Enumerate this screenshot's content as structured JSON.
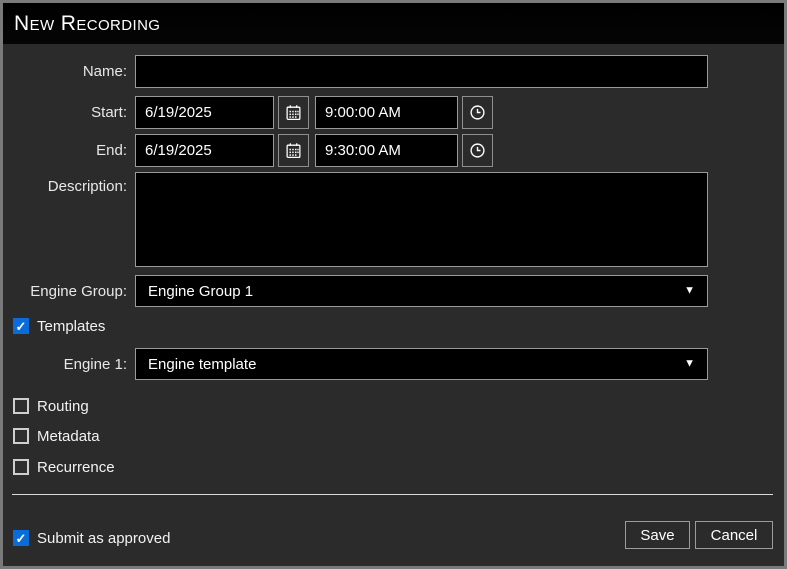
{
  "window": {
    "title": "New Recording"
  },
  "form": {
    "name": {
      "label": "Name:",
      "value": ""
    },
    "start": {
      "label": "Start:",
      "date": "6/19/2025",
      "time": "9:00:00 AM"
    },
    "end": {
      "label": "End:",
      "date": "6/19/2025",
      "time": "9:30:00 AM"
    },
    "description": {
      "label": "Description:",
      "value": ""
    },
    "engine_group": {
      "label": "Engine Group:",
      "selected": "Engine Group 1"
    },
    "engine_1": {
      "label": "Engine 1:",
      "selected": "Engine template"
    }
  },
  "checkboxes": {
    "templates": {
      "label": "Templates",
      "checked": true
    },
    "routing": {
      "label": "Routing",
      "checked": false
    },
    "metadata": {
      "label": "Metadata",
      "checked": false
    },
    "recurrence": {
      "label": "Recurrence",
      "checked": false
    },
    "submit_as_approved": {
      "label": "Submit as approved",
      "checked": true
    }
  },
  "buttons": {
    "save": "Save",
    "cancel": "Cancel"
  },
  "icons": {
    "calendar": "calendar-icon",
    "clock": "clock-icon",
    "dropdown_arrow": "▼"
  },
  "colors": {
    "accent_blue": "#0a6cd8",
    "window_bg": "#2b2b2b",
    "titlebar_bg": "#000000",
    "field_bg": "#000000",
    "field_border": "#9a9a9a",
    "divider": "#dadada",
    "text": "#ffffff"
  }
}
